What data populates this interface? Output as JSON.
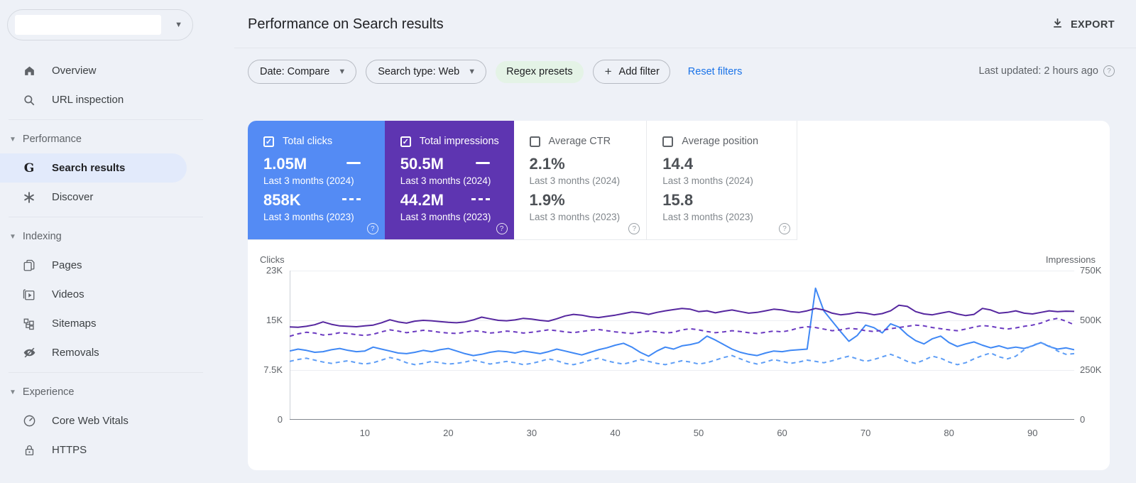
{
  "sidebar": {
    "property": {
      "value": ""
    },
    "overview": "Overview",
    "url_inspection": "URL inspection",
    "performance_header": "Performance",
    "search_results": "Search results",
    "discover": "Discover",
    "indexing_header": "Indexing",
    "pages": "Pages",
    "videos": "Videos",
    "sitemaps": "Sitemaps",
    "removals": "Removals",
    "experience_header": "Experience",
    "core_web_vitals": "Core Web Vitals",
    "https": "HTTPS"
  },
  "header": {
    "title": "Performance on Search results",
    "export_label": "EXPORT"
  },
  "filters": {
    "date_chip": "Date: Compare",
    "search_type_chip": "Search type: Web",
    "regex_chip": "Regex presets",
    "add_filter_label": "Add filter",
    "reset_label": "Reset filters",
    "last_updated": "Last updated: 2 hours ago"
  },
  "colors": {
    "clicks_card": "#548bf4",
    "impressions_card": "#5e35b1",
    "clicks_line_2024": "#3f88f5",
    "clicks_line_2023": "#5f9ef6",
    "impressions_line_2024": "#56279f",
    "impressions_line_2023": "#6b3ac1",
    "link_blue": "#1a73e8",
    "regex_chip_bg": "#e4f3e6",
    "selected_nav_bg": "#e2eafb",
    "page_bg": "#eef1f7"
  },
  "metrics": {
    "cards": [
      {
        "label": "Total clicks",
        "checked": true,
        "rows": [
          {
            "value": "1.05M",
            "period": "Last 3 months (2024)",
            "line": "solid"
          },
          {
            "value": "858K",
            "period": "Last 3 months (2023)",
            "line": "dashed"
          }
        ]
      },
      {
        "label": "Total impressions",
        "checked": true,
        "rows": [
          {
            "value": "50.5M",
            "period": "Last 3 months (2024)",
            "line": "solid"
          },
          {
            "value": "44.2M",
            "period": "Last 3 months (2023)",
            "line": "dashed"
          }
        ]
      },
      {
        "label": "Average CTR",
        "checked": false,
        "rows": [
          {
            "value": "2.1%",
            "period": "Last 3 months (2024)"
          },
          {
            "value": "1.9%",
            "period": "Last 3 months (2023)"
          }
        ]
      },
      {
        "label": "Average position",
        "checked": false,
        "rows": [
          {
            "value": "14.4",
            "period": "Last 3 months (2024)"
          },
          {
            "value": "15.8",
            "period": "Last 3 months (2023)"
          }
        ]
      }
    ]
  },
  "chart_data": {
    "type": "line",
    "title": "Clicks and impressions, last 3 months 2024 vs 2023, by day",
    "grid": true,
    "legend_position": "none",
    "x": {
      "unit": "day index",
      "count": 95,
      "tick_days": [
        10,
        20,
        30,
        40,
        50,
        60,
        70,
        80,
        90
      ]
    },
    "y_left": {
      "label": "Clicks",
      "unit": "thousands",
      "max": 23,
      "ticks": [
        "23K",
        "15K",
        "7.5K",
        "0"
      ]
    },
    "y_right": {
      "label": "Impressions",
      "unit": "thousands",
      "max": 750,
      "ticks": [
        "750K",
        "500K",
        "250K",
        "0"
      ]
    },
    "series": [
      {
        "name": "Total clicks — Last 3 months (2024)",
        "axis": "left",
        "style": "solid",
        "color": "#3f88f5",
        "values": [
          10.6,
          10.9,
          10.7,
          10.4,
          10.5,
          10.8,
          11.0,
          10.7,
          10.5,
          10.6,
          11.2,
          10.9,
          10.6,
          10.3,
          10.2,
          10.4,
          10.7,
          10.5,
          10.8,
          11.0,
          10.6,
          10.2,
          9.9,
          10.1,
          10.4,
          10.6,
          10.5,
          10.3,
          10.6,
          10.4,
          10.2,
          10.5,
          10.9,
          10.6,
          10.3,
          10.0,
          10.4,
          10.8,
          11.1,
          11.5,
          11.8,
          11.2,
          10.4,
          9.8,
          10.6,
          11.2,
          10.9,
          11.4,
          11.6,
          11.9,
          12.9,
          12.3,
          11.6,
          10.9,
          10.4,
          10.1,
          9.9,
          10.3,
          10.6,
          10.5,
          10.7,
          10.8,
          10.9,
          20.3,
          16.8,
          15.2,
          13.6,
          12.1,
          13.0,
          14.6,
          14.2,
          13.4,
          14.8,
          14.3,
          13.1,
          12.2,
          11.7,
          12.5,
          12.9,
          11.9,
          11.3,
          11.7,
          12.0,
          11.5,
          11.1,
          11.4,
          11.0,
          11.2,
          11.0,
          11.4,
          11.9,
          11.3,
          10.9,
          11.1,
          10.8
        ]
      },
      {
        "name": "Total clicks — Last 3 months (2023)",
        "axis": "left",
        "style": "dashed",
        "color": "#5f9ef6",
        "values": [
          9.0,
          9.3,
          9.5,
          9.2,
          8.9,
          8.7,
          8.9,
          9.1,
          8.8,
          8.6,
          8.8,
          9.2,
          9.6,
          9.3,
          8.8,
          8.5,
          8.7,
          9.0,
          8.8,
          8.6,
          8.7,
          8.9,
          9.2,
          8.9,
          8.6,
          8.8,
          9.0,
          8.8,
          8.5,
          8.7,
          9.0,
          9.4,
          9.1,
          8.7,
          8.5,
          8.8,
          9.2,
          9.5,
          9.1,
          8.8,
          8.6,
          8.9,
          9.3,
          9.0,
          8.7,
          8.5,
          8.8,
          9.1,
          8.9,
          8.6,
          8.8,
          9.2,
          9.6,
          9.9,
          9.4,
          8.9,
          8.6,
          8.9,
          9.3,
          9.0,
          8.7,
          8.9,
          9.2,
          9.0,
          8.8,
          9.1,
          9.5,
          9.8,
          9.4,
          9.0,
          9.3,
          9.7,
          10.1,
          9.6,
          9.0,
          8.7,
          9.2,
          9.8,
          9.5,
          8.9,
          8.5,
          8.8,
          9.4,
          9.9,
          10.3,
          9.7,
          9.4,
          9.8,
          10.8,
          11.5,
          11.9,
          11.4,
          10.6,
          10.1,
          10.2
        ]
      },
      {
        "name": "Total impressions — Last 3 months (2024)",
        "axis": "right",
        "style": "solid",
        "color": "#56279f",
        "values": [
          467,
          465,
          470,
          478,
          492,
          480,
          472,
          470,
          468,
          472,
          476,
          488,
          503,
          492,
          486,
          496,
          500,
          498,
          494,
          490,
          488,
          492,
          502,
          516,
          508,
          500,
          498,
          502,
          510,
          506,
          500,
          496,
          508,
          522,
          530,
          526,
          518,
          514,
          520,
          526,
          534,
          542,
          538,
          530,
          540,
          548,
          554,
          560,
          556,
          544,
          548,
          538,
          546,
          552,
          544,
          536,
          540,
          548,
          556,
          552,
          544,
          540,
          548,
          560,
          552,
          536,
          528,
          532,
          540,
          536,
          528,
          534,
          548,
          576,
          570,
          544,
          532,
          528,
          536,
          544,
          532,
          524,
          530,
          560,
          552,
          536,
          540,
          548,
          536,
          532,
          540,
          548,
          544,
          546,
          545
        ]
      },
      {
        "name": "Total impressions — Last 3 months (2023)",
        "axis": "right",
        "style": "dashed",
        "color": "#6b3ac1",
        "values": [
          420,
          432,
          440,
          436,
          426,
          430,
          438,
          434,
          428,
          424,
          430,
          442,
          452,
          446,
          438,
          444,
          450,
          446,
          440,
          436,
          434,
          440,
          448,
          444,
          436,
          440,
          446,
          442,
          436,
          440,
          446,
          452,
          448,
          442,
          438,
          444,
          450,
          454,
          448,
          442,
          438,
          434,
          440,
          446,
          442,
          436,
          440,
          452,
          458,
          452,
          444,
          438,
          442,
          448,
          444,
          438,
          434,
          440,
          446,
          442,
          450,
          462,
          468,
          464,
          456,
          448,
          452,
          460,
          456,
          448,
          444,
          450,
          458,
          464,
          470,
          476,
          472,
          464,
          458,
          452,
          448,
          456,
          466,
          474,
          470,
          462,
          456,
          462,
          470,
          476,
          486,
          502,
          510,
          496,
          478
        ]
      }
    ]
  }
}
